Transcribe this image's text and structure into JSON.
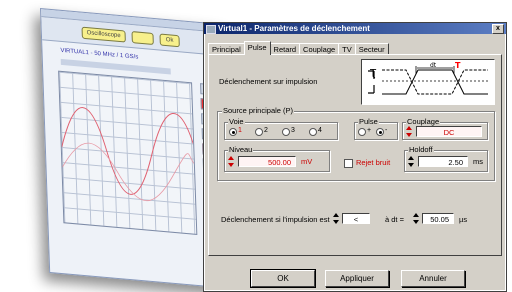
{
  "background_window": {
    "toolbar_buttons": [
      "Oscilloscope",
      "",
      "Ok"
    ],
    "header_text": "VIRTUAL1 - 50 MHz / 1 GS/s"
  },
  "dialog": {
    "title": "Virtual1 - Paramètres de déclenchement",
    "close_glyph": "x",
    "tabs": [
      "Principal",
      "Pulse",
      "Retard",
      "Couplage",
      "TV",
      "Secteur"
    ],
    "active_tab": "Pulse",
    "trigger_label": "Déclenchement sur impulsion",
    "pulse_diagram": {
      "dt_label": "dt",
      "marker_label": "T"
    },
    "source_group": {
      "title": "Source principale (P)",
      "voie": {
        "title": "Voie",
        "options": [
          "1",
          "2",
          "3",
          "4"
        ],
        "selected": "1"
      },
      "pulse": {
        "title": "Pulse",
        "options": [
          "+",
          "-"
        ],
        "selected": "-"
      },
      "couplage": {
        "title": "Couplage",
        "value": "DC"
      },
      "niveau": {
        "title": "Niveau",
        "value": "500.00",
        "unit": "mV"
      },
      "rejet_bruit": {
        "label": "Rejet bruit",
        "checked": false
      },
      "holdoff": {
        "title": "Holdoff",
        "value": "2.50",
        "unit": "ms"
      }
    },
    "condition": {
      "label": "Déclenchement si l'impulsion est",
      "operator": "<",
      "dt_prefix": "à dt =",
      "dt_value": "50.05",
      "dt_unit": "µs"
    },
    "buttons": {
      "ok": "OK",
      "apply": "Appliquer",
      "cancel": "Annuler"
    }
  },
  "colors": {
    "title_start": "#0a246a",
    "title_end": "#5c7ec4",
    "value_red": "#cc0000",
    "trigger_marker": "#ff0000"
  }
}
